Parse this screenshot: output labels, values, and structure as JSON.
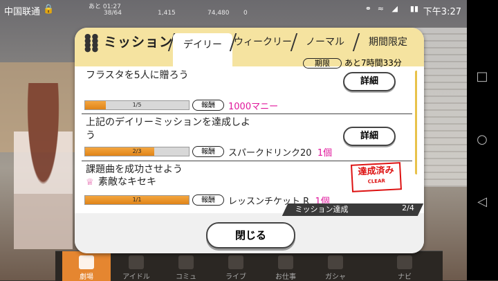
{
  "status_bar": {
    "carrier": "中国联通",
    "time": "下午3:27"
  },
  "game_hud": {
    "timer": "あと 01:27",
    "stamina": "38/64",
    "coins": "1,415",
    "money": "74,480",
    "jewels": "0"
  },
  "modal": {
    "title": "ミッション",
    "tabs": [
      "デイリー",
      "ウィークリー",
      "ノーマル",
      "期間限定"
    ],
    "active_tab": "デイリー",
    "limit_badge": "期限",
    "limit_value": "あと7時間33分",
    "missions": [
      {
        "title": "フラスタを5人に贈ろう",
        "detail_label": "詳細",
        "progress_text": "1/5",
        "progress_fraction": 0.2,
        "reward_badge": "報酬",
        "reward_text": "",
        "reward_highlight": "1000マニー"
      },
      {
        "title": "上記のデイリーミッションを達成しよう",
        "detail_label": "詳細",
        "progress_text": "2/3",
        "progress_fraction": 0.667,
        "reward_badge": "報酬",
        "reward_text": "スパークドリンク20",
        "reward_highlight": "1個"
      },
      {
        "title": "課題曲を成功させよう",
        "subtitle": "素敵なキセキ",
        "stamp_main": "達成済み",
        "stamp_sub": "CLEAR",
        "progress_text": "1/1",
        "progress_fraction": 1.0,
        "reward_badge": "報酬",
        "reward_text": "レッスンチケット R",
        "reward_highlight": "1個"
      }
    ],
    "achievement_label": "ミッション達成",
    "achievement_count": "2/4",
    "close_label": "閉じる"
  },
  "bottom_tabs": [
    "劇場",
    "アイドル",
    "コミュ",
    "ライブ",
    "お仕事",
    "ガシャ",
    "ナビ"
  ],
  "active_bottom_tab": "劇場"
}
